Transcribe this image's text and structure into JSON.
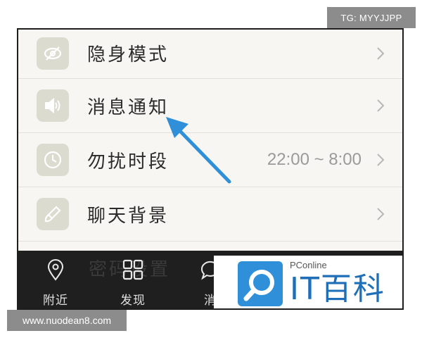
{
  "watermark_top": "TG: MYYJJPP",
  "watermark_bottom": "www.nuodean8.com",
  "settings": [
    {
      "label": "隐身模式",
      "icon": "eye-slash-icon",
      "value": ""
    },
    {
      "label": "消息通知",
      "icon": "speaker-icon",
      "value": ""
    },
    {
      "label": "勿扰时段",
      "icon": "clock-icon",
      "value": "22:00 ~ 8:00"
    },
    {
      "label": "聊天背景",
      "icon": "brush-icon",
      "value": ""
    }
  ],
  "partially_hidden_row": "密码设置",
  "tabs": [
    {
      "label": "附近",
      "icon": "location-pin-icon"
    },
    {
      "label": "发现",
      "icon": "grid-icon"
    },
    {
      "label": "消",
      "icon": "chat-bubble-icon"
    }
  ],
  "overlay": {
    "small_text": "PConline",
    "brand_text": "IT百科",
    "brand_color": "#1e6fb8"
  },
  "colors": {
    "arrow": "#2f8fd8",
    "tab_bar": "#1f1f1f",
    "list_bg": "#f7f6f2"
  }
}
